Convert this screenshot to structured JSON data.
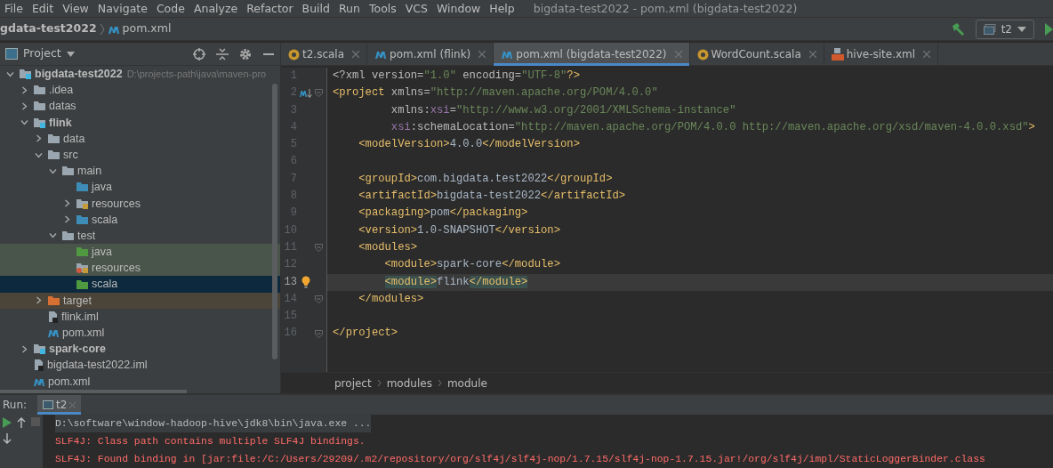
{
  "menu": [
    "File",
    "Edit",
    "View",
    "Navigate",
    "Code",
    "Analyze",
    "Refactor",
    "Build",
    "Run",
    "Tools",
    "VCS",
    "Window",
    "Help"
  ],
  "window": {
    "title": "bigdata-test2022 - pom.xml (bigdata-test2022)"
  },
  "breadcrumb": {
    "project": "gdata-test2022",
    "file": "pom.xml"
  },
  "run_config": {
    "name": "t2"
  },
  "project_panel": {
    "title": "Project"
  },
  "tree": [
    {
      "label": "bigdata-test2022",
      "path": "D:\\projects-path\\java\\maven-pro",
      "kind": "module",
      "expanded": true,
      "selected": false,
      "children": [
        {
          "label": ".idea",
          "kind": "folder",
          "expanded": false,
          "selected": false
        },
        {
          "label": "datas",
          "kind": "folder",
          "expanded": false,
          "selected": false
        },
        {
          "label": "flink",
          "kind": "module",
          "expanded": true,
          "selected": false,
          "children": [
            {
              "label": "data",
              "kind": "folder",
              "expanded": false,
              "selected": false
            },
            {
              "label": "src",
              "kind": "folder",
              "expanded": true,
              "selected": false,
              "children": [
                {
                  "label": "main",
                  "kind": "folder",
                  "expanded": true,
                  "selected": false,
                  "children": [
                    {
                      "label": "java",
                      "kind": "source",
                      "selected": false
                    },
                    {
                      "label": "resources",
                      "kind": "resources",
                      "expanded": false,
                      "selected": false
                    },
                    {
                      "label": "scala",
                      "kind": "source",
                      "expanded": false,
                      "selected": false
                    }
                  ]
                },
                {
                  "label": "test",
                  "kind": "folder",
                  "expanded": true,
                  "selected": false,
                  "children": [
                    {
                      "label": "java",
                      "kind": "test-source",
                      "selected": false
                    },
                    {
                      "label": "resources",
                      "kind": "test-resources",
                      "selected": false
                    },
                    {
                      "label": "scala",
                      "kind": "test-source",
                      "selected": true
                    }
                  ]
                }
              ]
            },
            {
              "label": "target",
              "kind": "excluded",
              "expanded": false,
              "selected": false
            },
            {
              "label": "flink.iml",
              "kind": "iml",
              "selected": false
            },
            {
              "label": "pom.xml",
              "kind": "maven",
              "selected": false
            }
          ]
        },
        {
          "label": "spark-core",
          "kind": "module",
          "expanded": false,
          "selected": false
        },
        {
          "label": "bigdata-test2022.iml",
          "kind": "iml",
          "selected": false
        },
        {
          "label": "pom.xml",
          "kind": "maven",
          "selected": false
        }
      ]
    }
  ],
  "tabs": [
    {
      "label": "t2.scala",
      "kind": "scala",
      "selected": false
    },
    {
      "label": "pom.xml (flink)",
      "kind": "maven",
      "selected": false
    },
    {
      "label": "pom.xml (bigdata-test2022)",
      "kind": "maven",
      "selected": true
    },
    {
      "label": "WordCount.scala",
      "kind": "scala",
      "selected": false
    },
    {
      "label": "hive-site.xml",
      "kind": "xml",
      "selected": false
    }
  ],
  "code": [
    {
      "number": "1",
      "current": false,
      "fold": false,
      "kind": "plain",
      "tokens": [
        {
          "kind": "attr",
          "text": "<?xml version="
        },
        {
          "kind": "value",
          "text": "\"1.0\""
        },
        {
          "kind": "attr",
          "text": " encoding="
        },
        {
          "kind": "value",
          "text": "\"UTF-8\""
        },
        {
          "kind": "tag",
          "text": "?>"
        }
      ]
    },
    {
      "number": "2",
      "current": false,
      "fold": true,
      "kind": "maven",
      "tokens": [
        {
          "kind": "tag",
          "text": "<project"
        },
        {
          "kind": "attr",
          "text": " xmlns="
        },
        {
          "kind": "value",
          "text": "\"http://maven.apache.org/POM/4.0.0\""
        }
      ]
    },
    {
      "number": "3",
      "current": false,
      "fold": false,
      "kind": "plain",
      "tokens": [
        {
          "kind": "attr",
          "text": "         xmlns:"
        },
        {
          "kind": "ns",
          "text": "xsi"
        },
        {
          "kind": "attr",
          "text": "="
        },
        {
          "kind": "value",
          "text": "\"http://www.w3.org/2001/XMLSchema-instance\""
        }
      ]
    },
    {
      "number": "4",
      "current": false,
      "fold": false,
      "kind": "plain",
      "tokens": [
        {
          "kind": "ns",
          "text": "         xsi"
        },
        {
          "kind": "attr",
          "text": ":schemaLocation="
        },
        {
          "kind": "value",
          "text": "\"http://maven.apache.org/POM/4.0.0 http://maven.apache.org/xsd/maven-4.0.0.xsd\""
        },
        {
          "kind": "tag",
          "text": ">"
        }
      ]
    },
    {
      "number": "5",
      "current": false,
      "fold": false,
      "kind": "plain",
      "tokens": [
        {
          "kind": "tag",
          "text": "    <modelVersion>"
        },
        {
          "kind": "text",
          "text": "4.0.0"
        },
        {
          "kind": "tag",
          "text": "</modelVersion>"
        }
      ]
    },
    {
      "number": "6",
      "current": false,
      "fold": false,
      "kind": "plain"
    },
    {
      "number": "7",
      "current": false,
      "fold": false,
      "kind": "plain",
      "tokens": [
        {
          "kind": "tag",
          "text": "    <groupId>"
        },
        {
          "kind": "text",
          "text": "com.bigdata.test2022"
        },
        {
          "kind": "tag",
          "text": "</groupId>"
        }
      ]
    },
    {
      "number": "8",
      "current": false,
      "fold": false,
      "kind": "plain",
      "tokens": [
        {
          "kind": "tag",
          "text": "    <artifactId>"
        },
        {
          "kind": "text",
          "text": "bigdata-test2022"
        },
        {
          "kind": "tag",
          "text": "</artifactId>"
        }
      ]
    },
    {
      "number": "9",
      "current": false,
      "fold": false,
      "kind": "plain",
      "tokens": [
        {
          "kind": "tag",
          "text": "    <packaging>"
        },
        {
          "kind": "text",
          "text": "pom"
        },
        {
          "kind": "tag",
          "text": "</packaging>"
        }
      ]
    },
    {
      "number": "10",
      "current": false,
      "fold": false,
      "kind": "plain",
      "tokens": [
        {
          "kind": "tag",
          "text": "    <version>"
        },
        {
          "kind": "text",
          "text": "1.0-SNAPSHOT"
        },
        {
          "kind": "tag",
          "text": "</version>"
        }
      ]
    },
    {
      "number": "11",
      "current": false,
      "fold": true,
      "kind": "plain",
      "tokens": [
        {
          "kind": "tag",
          "text": "    <modules>"
        }
      ]
    },
    {
      "number": "12",
      "current": false,
      "fold": false,
      "kind": "plain",
      "tokens": [
        {
          "kind": "tag",
          "text": "        <module>"
        },
        {
          "kind": "text",
          "text": "spark-core"
        },
        {
          "kind": "tag",
          "text": "</module>"
        }
      ]
    },
    {
      "number": "13",
      "current": true,
      "fold": false,
      "kind": "bulb",
      "tokens": [
        {
          "kind": "tag-match",
          "text": "<module>"
        },
        {
          "kind": "text",
          "text": "flink"
        },
        {
          "kind": "tag-match",
          "text": "</module>"
        }
      ]
    },
    {
      "number": "14",
      "current": false,
      "fold": true,
      "kind": "plain",
      "tokens": [
        {
          "kind": "tag",
          "text": "    </modules>"
        }
      ]
    },
    {
      "number": "15",
      "current": false,
      "fold": false,
      "kind": "plain"
    },
    {
      "number": "16",
      "current": false,
      "fold": true,
      "kind": "plain",
      "tokens": [
        {
          "kind": "tag",
          "text": "</project>"
        }
      ]
    }
  ],
  "editor_breadcrumb": [
    "project",
    "modules",
    "module"
  ],
  "run_panel": {
    "label": "Run:",
    "tab": "t2",
    "console": [
      {
        "kind": "command",
        "text": "D:\\software\\window-hadoop-hive\\jdk8\\bin\\java.exe ..."
      },
      {
        "kind": "error",
        "text": "SLF4J: Class path contains multiple SLF4J bindings."
      },
      {
        "kind": "error",
        "text": "SLF4J: Found binding in [jar:file:/C:/Users/29209/.m2/repository/org/slf4j/slf4j-nop/1.7.15/slf4j-nop-1.7.15.jar!/org/slf4j/impl/StaticLoggerBinder.class"
      }
    ]
  }
}
